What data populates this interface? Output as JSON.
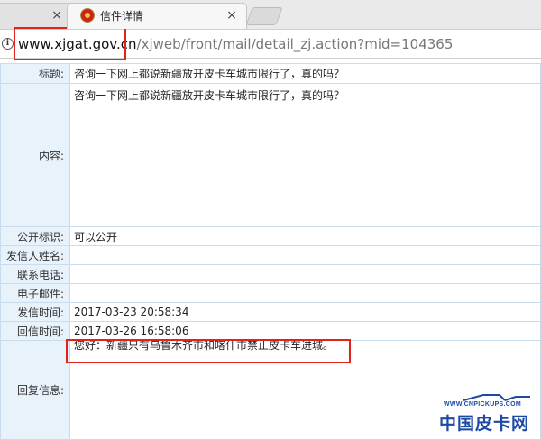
{
  "browser": {
    "tabs": [
      {
        "label": "",
        "close": "×"
      },
      {
        "label": "信件详情",
        "close": "×"
      }
    ],
    "address": {
      "info_glyph": "i",
      "host": "www.xjgat.gov.cn",
      "path": "/xjweb/front/mail/detail_zj.action?mid=104365"
    }
  },
  "detail": {
    "rows": [
      {
        "label": "标题:",
        "value": "咨询一下网上都说新疆放开皮卡车城市限行了，真的吗？"
      },
      {
        "label": "内容:",
        "value": "咨询一下网上都说新疆放开皮卡车城市限行了，真的吗？"
      },
      {
        "label": "公开标识:",
        "value": "可以公开"
      },
      {
        "label": "发信人姓名:",
        "value": ""
      },
      {
        "label": "联系电话:",
        "value": ""
      },
      {
        "label": "电子邮件:",
        "value": ""
      },
      {
        "label": "发信时间:",
        "value": "2017-03-23 20:58:34"
      },
      {
        "label": "回信时间:",
        "value": "2017-03-26 16:58:06"
      },
      {
        "label": "回复信息:",
        "value": "您好：新疆只有乌鲁木齐市和喀什市禁止皮卡车进城。"
      }
    ]
  },
  "watermark": {
    "url": "WWW.CNPICKUPS.COM",
    "name": "中国皮卡网"
  },
  "colors": {
    "label_bg": "#e8f2fb",
    "border": "#c9dcee",
    "highlight": "#e2231a",
    "watermark": "#1d4aa3"
  }
}
